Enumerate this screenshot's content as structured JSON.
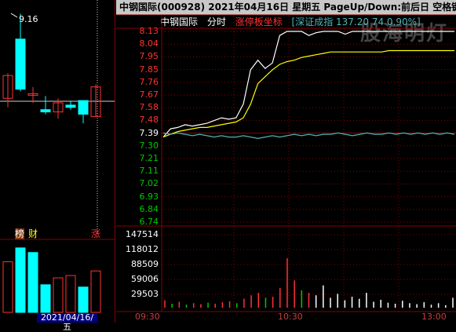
{
  "header": {
    "title_text": "中钢国际(000928)  2021年04月16日 星期五 PageUp/Down:前后日 空格键:操作"
  },
  "subheader": {
    "stock_name": "中钢国际",
    "mode": "分时",
    "limit_coord": "涨停板坐标",
    "index_info": "[深证成指 137.20 74 0.90%]"
  },
  "watermark": "股海明灯",
  "kline": {
    "high_label": "9.16",
    "badges": [
      "榜",
      "财",
      "涨"
    ],
    "date": "2021/04/16/五"
  },
  "price_axis": [
    "8.13",
    "8.04",
    "7.95",
    "7.85",
    "7.76",
    "7.67",
    "7.58",
    "7.48",
    "7.39",
    "7.30",
    "7.21",
    "7.11",
    "7.02",
    "6.93",
    "6.84",
    "6.74"
  ],
  "volume_axis": [
    "147514",
    "118012",
    "88509",
    "59006",
    "29503"
  ],
  "time_axis": [
    "09:30",
    "10:30",
    "13:00"
  ],
  "colors": {
    "up": "#ff3232",
    "down": "#00ffff",
    "flat": "#ffffff",
    "avg_line": "#ffff00",
    "index_line": "#4fb4b4",
    "grid": "#8a0000",
    "axis_green": "#00c800"
  },
  "chart_data": [
    {
      "type": "candlestick",
      "title": "",
      "candles": [
        {
          "open": 7.3,
          "close": 7.8,
          "high": 7.85,
          "low": 7.1
        },
        {
          "open": 8.6,
          "close": 7.5,
          "high": 9.16,
          "low": 7.45
        },
        {
          "open": 7.4,
          "close": 7.4,
          "high": 7.55,
          "low": 7.2
        },
        {
          "open": 7.05,
          "close": 7.0,
          "high": 7.35,
          "low": 6.95
        },
        {
          "open": 7.0,
          "close": 7.2,
          "high": 7.3,
          "low": 6.85
        },
        {
          "open": 7.15,
          "close": 7.1,
          "high": 7.25,
          "low": 7.05
        },
        {
          "open": 7.25,
          "close": 6.95,
          "high": 7.25,
          "low": 6.75
        },
        {
          "open": 6.9,
          "close": 7.55,
          "high": 7.6,
          "low": 6.9
        }
      ],
      "volumes": [
        {
          "value": 110000,
          "dir": "up"
        },
        {
          "value": 140000,
          "dir": "down"
        },
        {
          "value": 130000,
          "dir": "down"
        },
        {
          "value": 60000,
          "dir": "down"
        },
        {
          "value": 75000,
          "dir": "up"
        },
        {
          "value": 80000,
          "dir": "up"
        },
        {
          "value": 55000,
          "dir": "down"
        },
        {
          "value": 90000,
          "dir": "up"
        }
      ]
    },
    {
      "type": "line",
      "title": "中钢国际 分时",
      "ylim": [
        6.74,
        8.13
      ],
      "prev_close": 7.39,
      "x_ticks": [
        "09:30",
        "10:30",
        "13:00"
      ],
      "series": [
        {
          "name": "price",
          "values": [
            7.36,
            7.42,
            7.43,
            7.45,
            7.44,
            7.45,
            7.46,
            7.48,
            7.5,
            7.49,
            7.5,
            7.6,
            7.85,
            7.92,
            7.86,
            7.9,
            8.1,
            8.13,
            8.13,
            8.13,
            8.1,
            8.12,
            8.13,
            8.13,
            8.13,
            8.11,
            8.13,
            8.13,
            8.13,
            8.13,
            8.13,
            8.13,
            8.13,
            8.13,
            8.13,
            8.13,
            8.13,
            8.13,
            8.13,
            8.13,
            8.13
          ]
        },
        {
          "name": "avg",
          "values": [
            7.36,
            7.38,
            7.4,
            7.41,
            7.42,
            7.43,
            7.43,
            7.44,
            7.45,
            7.46,
            7.47,
            7.5,
            7.6,
            7.75,
            7.8,
            7.85,
            7.89,
            7.91,
            7.92,
            7.94,
            7.95,
            7.96,
            7.97,
            7.98,
            7.98,
            7.98,
            7.98,
            7.98,
            7.98,
            7.98,
            7.98,
            7.99,
            7.99,
            7.99,
            7.99,
            7.99,
            7.99,
            7.99,
            7.99,
            7.99,
            7.99
          ]
        },
        {
          "name": "index",
          "values": [
            7.39,
            7.38,
            7.39,
            7.38,
            7.37,
            7.38,
            7.37,
            7.36,
            7.37,
            7.36,
            7.36,
            7.37,
            7.36,
            7.35,
            7.36,
            7.37,
            7.36,
            7.37,
            7.38,
            7.37,
            7.38,
            7.37,
            7.38,
            7.38,
            7.39,
            7.38,
            7.37,
            7.38,
            7.39,
            7.38,
            7.38,
            7.39,
            7.38,
            7.39,
            7.38,
            7.39,
            7.38,
            7.39,
            7.38,
            7.39,
            7.38
          ]
        }
      ],
      "volume_ylim": [
        0,
        147514
      ],
      "volumes": [
        {
          "value": 15000,
          "dir": "up"
        },
        {
          "value": 8000,
          "dir": "down"
        },
        {
          "value": 12000,
          "dir": "up"
        },
        {
          "value": 6000,
          "dir": "down"
        },
        {
          "value": 9000,
          "dir": "up"
        },
        {
          "value": 7000,
          "dir": "up"
        },
        {
          "value": 10000,
          "dir": "down"
        },
        {
          "value": 8000,
          "dir": "up"
        },
        {
          "value": 11000,
          "dir": "up"
        },
        {
          "value": 13000,
          "dir": "up"
        },
        {
          "value": 9000,
          "dir": "down"
        },
        {
          "value": 18000,
          "dir": "up"
        },
        {
          "value": 25000,
          "dir": "up"
        },
        {
          "value": 30000,
          "dir": "up"
        },
        {
          "value": 20000,
          "dir": "down"
        },
        {
          "value": 22000,
          "dir": "up"
        },
        {
          "value": 40000,
          "dir": "up"
        },
        {
          "value": 100000,
          "dir": "up"
        },
        {
          "value": 55000,
          "dir": "up"
        },
        {
          "value": 35000,
          "dir": "down"
        },
        {
          "value": 30000,
          "dir": "up"
        },
        {
          "value": 25000,
          "dir": "flat"
        },
        {
          "value": 45000,
          "dir": "flat"
        },
        {
          "value": 20000,
          "dir": "flat"
        },
        {
          "value": 28000,
          "dir": "flat"
        },
        {
          "value": 15000,
          "dir": "flat"
        },
        {
          "value": 22000,
          "dir": "flat"
        },
        {
          "value": 18000,
          "dir": "flat"
        },
        {
          "value": 30000,
          "dir": "flat"
        },
        {
          "value": 12000,
          "dir": "flat"
        },
        {
          "value": 16000,
          "dir": "flat"
        },
        {
          "value": 10000,
          "dir": "flat"
        },
        {
          "value": 8000,
          "dir": "flat"
        },
        {
          "value": 14000,
          "dir": "flat"
        },
        {
          "value": 9000,
          "dir": "flat"
        },
        {
          "value": 7000,
          "dir": "flat"
        },
        {
          "value": 11000,
          "dir": "flat"
        },
        {
          "value": 6000,
          "dir": "flat"
        },
        {
          "value": 9000,
          "dir": "flat"
        },
        {
          "value": 5000,
          "dir": "flat"
        },
        {
          "value": 20000,
          "dir": "flat"
        }
      ]
    }
  ]
}
